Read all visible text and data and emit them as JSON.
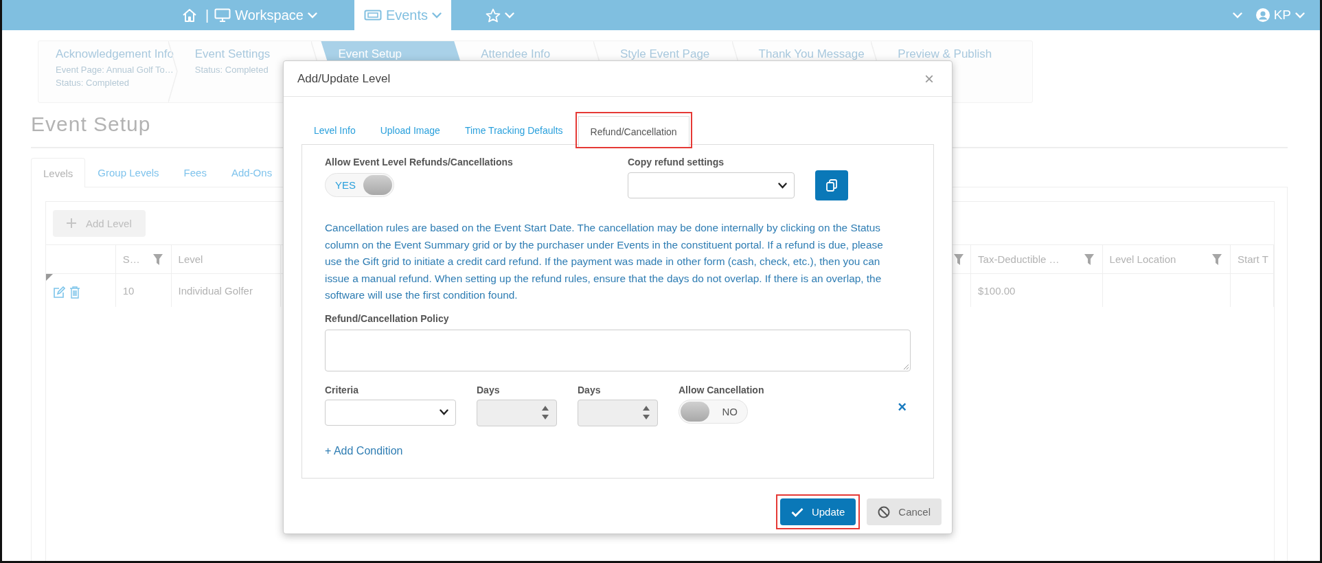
{
  "top_nav": {
    "separator": "|",
    "items": [
      {
        "label": "Workspace",
        "selected": false
      },
      {
        "label": "Events",
        "selected": true
      }
    ],
    "user": "KP"
  },
  "wizard": {
    "steps": [
      {
        "label": "Acknowledgement Info",
        "selected": false,
        "lines": [
          "Event Page: Annual Golf To…",
          "Status: Completed"
        ]
      },
      {
        "label": "Event Settings",
        "selected": false,
        "lines": [
          "Status: Completed"
        ]
      },
      {
        "label": "Event Setup",
        "selected": true
      },
      {
        "label": "Attendee Info",
        "selected": false
      },
      {
        "label": "Style Event Page",
        "selected": false
      },
      {
        "label": "Thank You Message",
        "selected": false
      },
      {
        "label": "Preview & Publish",
        "selected": false
      }
    ]
  },
  "page": {
    "title": "Event Setup",
    "tabs": [
      {
        "label": "Levels",
        "selected": true
      },
      {
        "label": "Group Levels",
        "selected": false
      },
      {
        "label": "Fees",
        "selected": false
      },
      {
        "label": "Add-Ons",
        "selected": false
      }
    ],
    "add_button": "Add Level",
    "grid": {
      "columns": [
        {
          "filter": false
        },
        {
          "label": "S…",
          "filter": true
        },
        {
          "label": "Level",
          "filter": false
        },
        {
          "filter": true
        },
        {
          "label": "Tax-Deductible …",
          "filter": true
        },
        {
          "label": "Level Location",
          "filter": true
        },
        {
          "label": "Start T",
          "filter": false
        }
      ],
      "rows": [
        {
          "s": "10",
          "level": "Individual Golfer",
          "tax_deductible": "$100.00"
        }
      ]
    }
  },
  "modal": {
    "title": "Add/Update Level",
    "close": "×",
    "tabs": [
      {
        "label": "Level Info",
        "selected": false,
        "highlighted": false
      },
      {
        "label": "Upload Image",
        "selected": false,
        "highlighted": false
      },
      {
        "label": "Time Tracking Defaults",
        "selected": false,
        "highlighted": false
      },
      {
        "label": "Refund/Cancellation",
        "selected": true,
        "highlighted": true
      }
    ],
    "allow_refunds": {
      "label": "Allow Event Level Refunds/Cancellations",
      "on": true,
      "text": "YES"
    },
    "copy_settings": {
      "label": "Copy refund settings"
    },
    "info": "Cancellation rules are based on the Event Start Date. The cancellation may be done internally by clicking on the Status column on the Event Summary grid or by the purchaser under Events in the constituent portal. If a refund is due, please use the Gift grid to initiate a credit card refund. If the payment was made in other form (cash, check, etc.), then you can issue a manual refund. When setting up the refund rules, ensure that the days do not overlap. If there is an overlap, the software will use the first condition found.",
    "policy": {
      "label": "Refund/Cancellation Policy"
    },
    "condition": {
      "criteria_label": "Criteria",
      "days_labels": [
        "Days",
        "Days"
      ],
      "allow_label": "Allow Cancellation",
      "allow": {
        "on": false,
        "text": "NO"
      },
      "remove": "×"
    },
    "add_condition": "+ Add Condition",
    "buttons": [
      {
        "label": "Update",
        "kind": "primary",
        "highlighted": true
      },
      {
        "label": "Cancel",
        "kind": "secondary",
        "highlighted": false
      }
    ]
  }
}
